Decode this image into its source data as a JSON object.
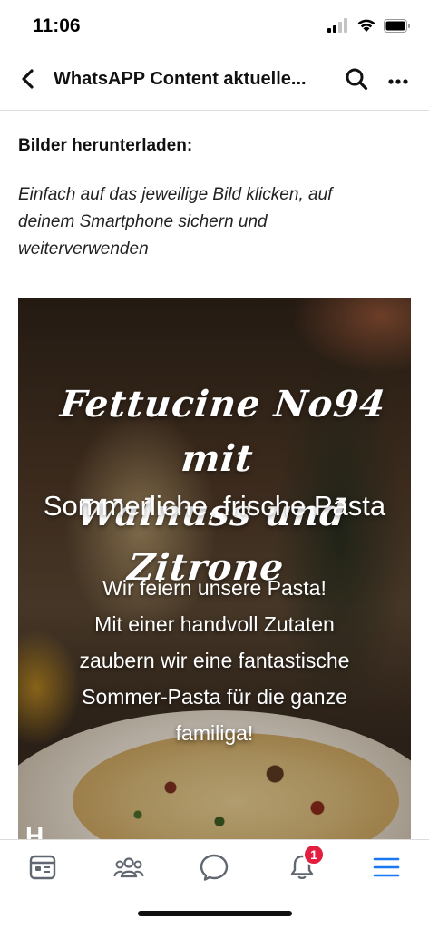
{
  "status_bar": {
    "time": "11:06",
    "icons": [
      "cellular-signal-icon",
      "wifi-icon",
      "battery-icon"
    ]
  },
  "nav": {
    "title": "WhatsAPP Content aktuelle...",
    "back_icon": "chevron-left-icon",
    "search_icon": "search-icon",
    "more_icon": "more-horizontal-icon"
  },
  "content": {
    "heading": "Bilder herunterladen:",
    "intro_lines": [
      "Einfach auf das jeweilige Bild klicken, auf",
      "deinem Smartphone sichern und",
      "weiterverwenden"
    ]
  },
  "promo": {
    "title_lines": [
      "Fettucine No94 mit",
      "Walnuss und Zitrone"
    ],
    "subtitle": "Sommerliche, frische Pasta",
    "body_lines": [
      "Wir feiern unsere Pasta!",
      "Mit einer handvoll Zutaten",
      "zaubern wir eine fantastische",
      "Sommer-Pasta für die ganze",
      "familiga!"
    ],
    "cut_text": "H"
  },
  "tab_bar": {
    "tabs": [
      {
        "name": "news-feed",
        "icon": "news-feed-icon"
      },
      {
        "name": "groups",
        "icon": "groups-icon"
      },
      {
        "name": "messenger",
        "icon": "chat-bubble-icon"
      },
      {
        "name": "notifications",
        "icon": "bell-icon"
      },
      {
        "name": "menu",
        "icon": "hamburger-menu-icon"
      }
    ],
    "notification_count": "1",
    "active_color": "#1877f2",
    "badge_color": "#e41e3f"
  }
}
